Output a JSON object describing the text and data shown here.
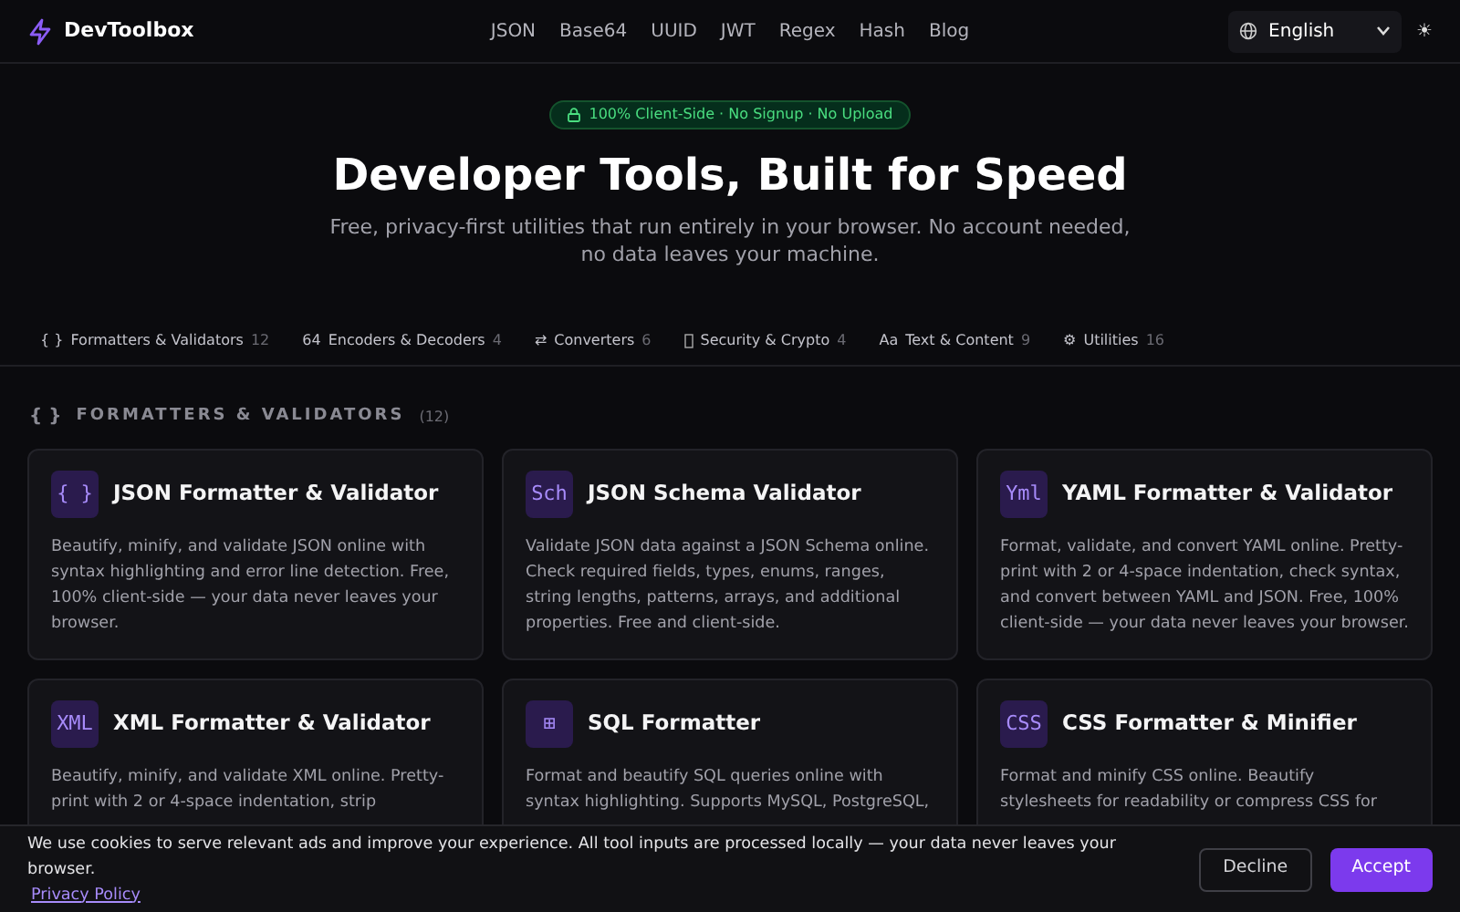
{
  "brand": {
    "name": "DevToolbox"
  },
  "nav": [
    "JSON",
    "Base64",
    "UUID",
    "JWT",
    "Regex",
    "Hash",
    "Blog"
  ],
  "language": {
    "value": "English"
  },
  "theme_toggle": "☀",
  "hero": {
    "badge": "100% Client-Side · No Signup · No Upload",
    "title": "Developer Tools, Built for Speed",
    "subtitle": "Free, privacy-first utilities that run entirely in your browser. No account needed, no data leaves your machine."
  },
  "categories": [
    {
      "glyph": "{ }",
      "label": "Formatters & Validators",
      "count": "12"
    },
    {
      "glyph": "64",
      "label": "Encoders & Decoders",
      "count": "4"
    },
    {
      "glyph": "⇄",
      "label": "Converters",
      "count": "6"
    },
    {
      "label": "Security & Crypto",
      "count": "4"
    },
    {
      "glyph": "Aa",
      "label": "Text & Content",
      "count": "9"
    },
    {
      "glyph": "⚙",
      "label": "Utilities",
      "count": "16"
    }
  ],
  "section": {
    "glyph": "{ }",
    "title": "FORMATTERS & VALIDATORS",
    "count": "(12)"
  },
  "tools": [
    {
      "icon": "{ }",
      "title": "JSON Formatter & Validator",
      "description": "Beautify, minify, and validate JSON online with syntax highlighting and error line detection. Free, 100% client-side — your data never leaves your browser."
    },
    {
      "icon": "Sch",
      "title": "JSON Schema Validator",
      "description": "Validate JSON data against a JSON Schema online. Check required fields, types, enums, ranges, string lengths, patterns, arrays, and additional properties. Free and client-side."
    },
    {
      "icon": "Yml",
      "title": "YAML Formatter & Validator",
      "description": "Format, validate, and convert YAML online. Pretty-print with 2 or 4-space indentation, check syntax, and convert between YAML and JSON. Free, 100% client-side — your data never leaves your browser."
    },
    {
      "icon": "XML",
      "title": "XML Formatter & Validator",
      "description": "Beautify, minify, and validate XML online. Pretty-print with 2 or 4-space indentation, strip"
    },
    {
      "icon": "⊞",
      "title": "SQL Formatter",
      "description": "Format and beautify SQL queries online with syntax highlighting. Supports MySQL, PostgreSQL,"
    },
    {
      "icon": "CSS",
      "title": "CSS Formatter & Minifier",
      "description": "Format and minify CSS online. Beautify stylesheets for readability or compress CSS for"
    }
  ],
  "cookie_banner": {
    "message": "We use cookies to serve relevant ads and improve your experience. All tool inputs are processed locally — your data never leaves your browser.",
    "link": "Privacy Policy",
    "buttons": [
      "Decline",
      "Accept"
    ]
  }
}
